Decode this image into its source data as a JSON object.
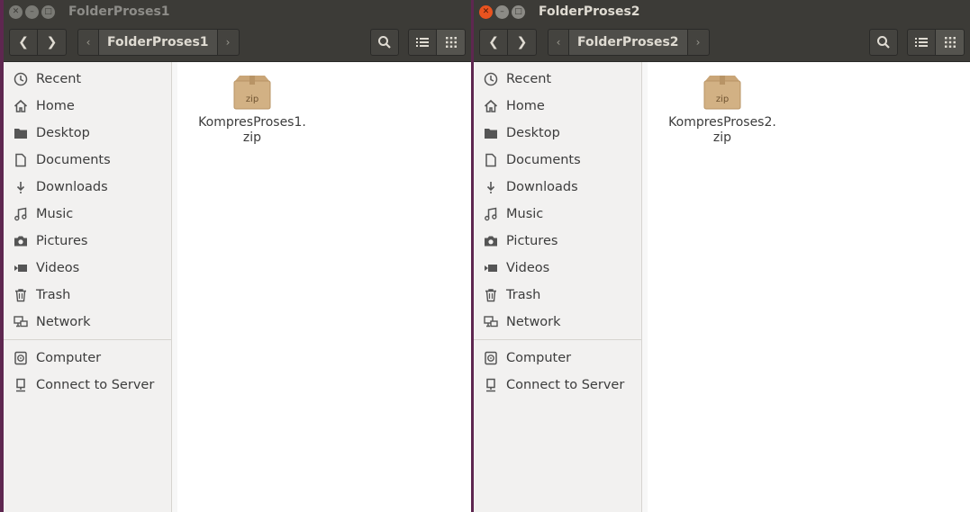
{
  "windows": [
    {
      "title": "FolderProses1",
      "active": false,
      "path": "FolderProses1",
      "sidebar": [
        {
          "label": "Recent",
          "icon": "clock-icon"
        },
        {
          "label": "Home",
          "icon": "home-icon"
        },
        {
          "label": "Desktop",
          "icon": "folder-icon"
        },
        {
          "label": "Documents",
          "icon": "document-icon"
        },
        {
          "label": "Downloads",
          "icon": "download-icon"
        },
        {
          "label": "Music",
          "icon": "music-icon"
        },
        {
          "label": "Pictures",
          "icon": "camera-icon"
        },
        {
          "label": "Videos",
          "icon": "video-icon"
        },
        {
          "label": "Trash",
          "icon": "trash-icon"
        },
        {
          "label": "Network",
          "icon": "network-icon"
        },
        {
          "label": "Computer",
          "icon": "computer-icon"
        },
        {
          "label": "Connect to Server",
          "icon": "server-icon"
        }
      ],
      "files": [
        {
          "name_line1": "KompresProses1.",
          "name_line2": "zip",
          "icon_label": "zip"
        }
      ]
    },
    {
      "title": "FolderProses2",
      "active": true,
      "path": "FolderProses2",
      "sidebar": [
        {
          "label": "Recent",
          "icon": "clock-icon"
        },
        {
          "label": "Home",
          "icon": "home-icon"
        },
        {
          "label": "Desktop",
          "icon": "folder-icon"
        },
        {
          "label": "Documents",
          "icon": "document-icon"
        },
        {
          "label": "Downloads",
          "icon": "download-icon"
        },
        {
          "label": "Music",
          "icon": "music-icon"
        },
        {
          "label": "Pictures",
          "icon": "camera-icon"
        },
        {
          "label": "Videos",
          "icon": "video-icon"
        },
        {
          "label": "Trash",
          "icon": "trash-icon"
        },
        {
          "label": "Network",
          "icon": "network-icon"
        },
        {
          "label": "Computer",
          "icon": "computer-icon"
        },
        {
          "label": "Connect to Server",
          "icon": "server-icon"
        }
      ],
      "files": [
        {
          "name_line1": "KompresProses2.",
          "name_line2": "zip",
          "icon_label": "zip"
        }
      ]
    }
  ],
  "colors": {
    "titlebar": "#3c3b37",
    "close_active": "#e9531f",
    "sidebar_bg": "#f2f1f0",
    "desktop_bg": "#5e2750"
  }
}
